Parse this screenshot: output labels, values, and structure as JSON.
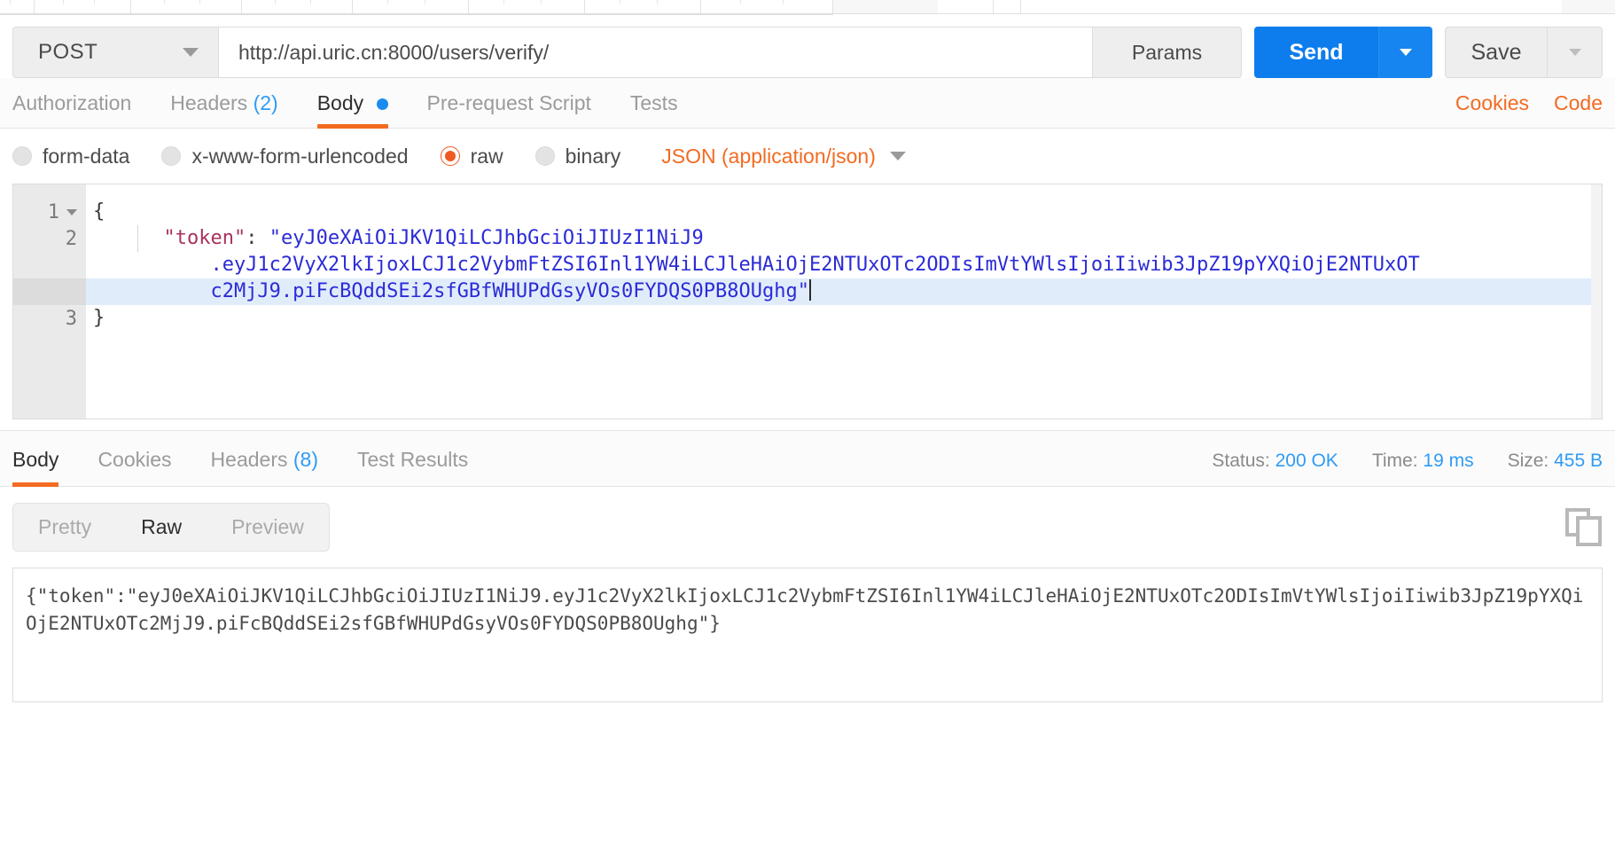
{
  "window": {
    "tabstrip_tab_count": 8
  },
  "request": {
    "method": "POST",
    "url": "http://api.uric.cn:8000/users/verify/",
    "params_label": "Params",
    "send_label": "Send",
    "save_label": "Save",
    "tabs": [
      {
        "label": "Authorization",
        "count": "",
        "active": false,
        "dot": false
      },
      {
        "label": "Headers",
        "count": "(2)",
        "active": false,
        "dot": false
      },
      {
        "label": "Body",
        "count": "",
        "active": true,
        "dot": true
      },
      {
        "label": "Pre-request Script",
        "count": "",
        "active": false,
        "dot": false
      },
      {
        "label": "Tests",
        "count": "",
        "active": false,
        "dot": false
      }
    ],
    "right_links": [
      {
        "label": "Cookies"
      },
      {
        "label": "Code"
      }
    ],
    "body_types": [
      {
        "label": "form-data",
        "selected": false
      },
      {
        "label": "x-www-form-urlencoded",
        "selected": false
      },
      {
        "label": "raw",
        "selected": true
      },
      {
        "label": "binary",
        "selected": false
      }
    ],
    "content_type": "JSON (application/json)",
    "editor": {
      "line_numbers": [
        "1",
        "2",
        "3"
      ],
      "line1": "{",
      "line2_key": "\"token\"",
      "line2_colon": ": ",
      "line2_value_part1": "\"eyJ0eXAiOiJKV1QiLCJhbGciOiJIUzI1NiJ9",
      "line2_value_part2": ".eyJ1c2VyX2lkIjoxLCJ1c2VybmFtZSI6Inl1YW4iLCJleHAiOjE2NTUxOTc2ODIsImVtYWlsIjoiIiwib3JpZ19pYXQiOjE2NTUxOT",
      "line2_value_part3": "c2MjJ9.piFcBQddSEi2sfGBfWHUPdGsyVOs0FYDQS0PB8OUghg\"",
      "line3": "}"
    }
  },
  "response": {
    "tabs": [
      {
        "label": "Body",
        "count": "",
        "active": true
      },
      {
        "label": "Cookies",
        "count": "",
        "active": false
      },
      {
        "label": "Headers",
        "count": "(8)",
        "active": false
      },
      {
        "label": "Test Results",
        "count": "",
        "active": false
      }
    ],
    "meta": {
      "status_label": "Status:",
      "status_value": "200 OK",
      "time_label": "Time:",
      "time_value": "19 ms",
      "size_label": "Size:",
      "size_value": "455 B"
    },
    "views": [
      {
        "label": "Pretty",
        "active": false
      },
      {
        "label": "Raw",
        "active": true
      },
      {
        "label": "Preview",
        "active": false
      }
    ],
    "copy_icon": "copy-icon",
    "body_text": "{\"token\":\"eyJ0eXAiOiJKV1QiLCJhbGciOiJIUzI1NiJ9.eyJ1c2VyX2lkIjoxLCJ1c2VybmFtZSI6Inl1YW4iLCJleHAiOjE2NTUxOTc2ODIsImVtYWlsIjoiIiwib3JpZ19pYXQiOjE2NTUxOTc2MjJ9.piFcBQddSEi2sfGBfWHUPdGsyVOs0FYDQS0PB8OUghg\"}"
  },
  "colors": {
    "accent_orange": "#f26b21",
    "accent_blue": "#0d7ded",
    "link_blue": "#2f9bf5",
    "string_blue": "#2b2bd6",
    "key_magenta": "#a8325e"
  }
}
